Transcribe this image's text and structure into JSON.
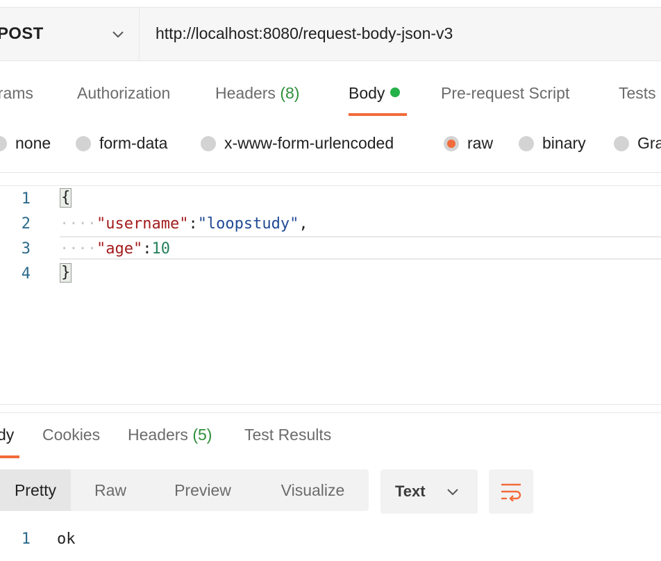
{
  "request": {
    "method": "POST",
    "url": "http://localhost:8080/request-body-json-v3"
  },
  "request_tabs": [
    {
      "label": "arams"
    },
    {
      "label": "Authorization"
    },
    {
      "label": "Headers",
      "count": "(8)"
    },
    {
      "label": "Body",
      "active": true
    },
    {
      "label": "Pre-request Script"
    },
    {
      "label": "Tests"
    }
  ],
  "body_types": [
    {
      "label": "none"
    },
    {
      "label": "form-data"
    },
    {
      "label": "x-www-form-urlencoded"
    },
    {
      "label": "raw",
      "selected": true
    },
    {
      "label": "binary"
    },
    {
      "label": "Gra"
    }
  ],
  "editor": {
    "line_numbers": [
      "1",
      "2",
      "3",
      "4"
    ],
    "open_brace": "{",
    "close_brace": "}",
    "line2": {
      "indent": "····",
      "key": "\"username\"",
      "colon": ":",
      "value": "\"loopstudy\"",
      "comma": ","
    },
    "line3": {
      "indent": "····",
      "key": "\"age\"",
      "colon": ":",
      "value": "10"
    }
  },
  "response_tabs": [
    {
      "label": "dy",
      "active": true
    },
    {
      "label": "Cookies"
    },
    {
      "label": "Headers",
      "count": "(5)"
    },
    {
      "label": "Test Results"
    }
  ],
  "view_modes": [
    {
      "label": "Pretty",
      "active": true
    },
    {
      "label": "Raw"
    },
    {
      "label": "Preview"
    },
    {
      "label": "Visualize"
    }
  ],
  "format": {
    "label": "Text"
  },
  "response": {
    "line_number": "1",
    "text": "ok"
  },
  "colors": {
    "accent": "#f26b3a",
    "success": "#26b24a"
  }
}
